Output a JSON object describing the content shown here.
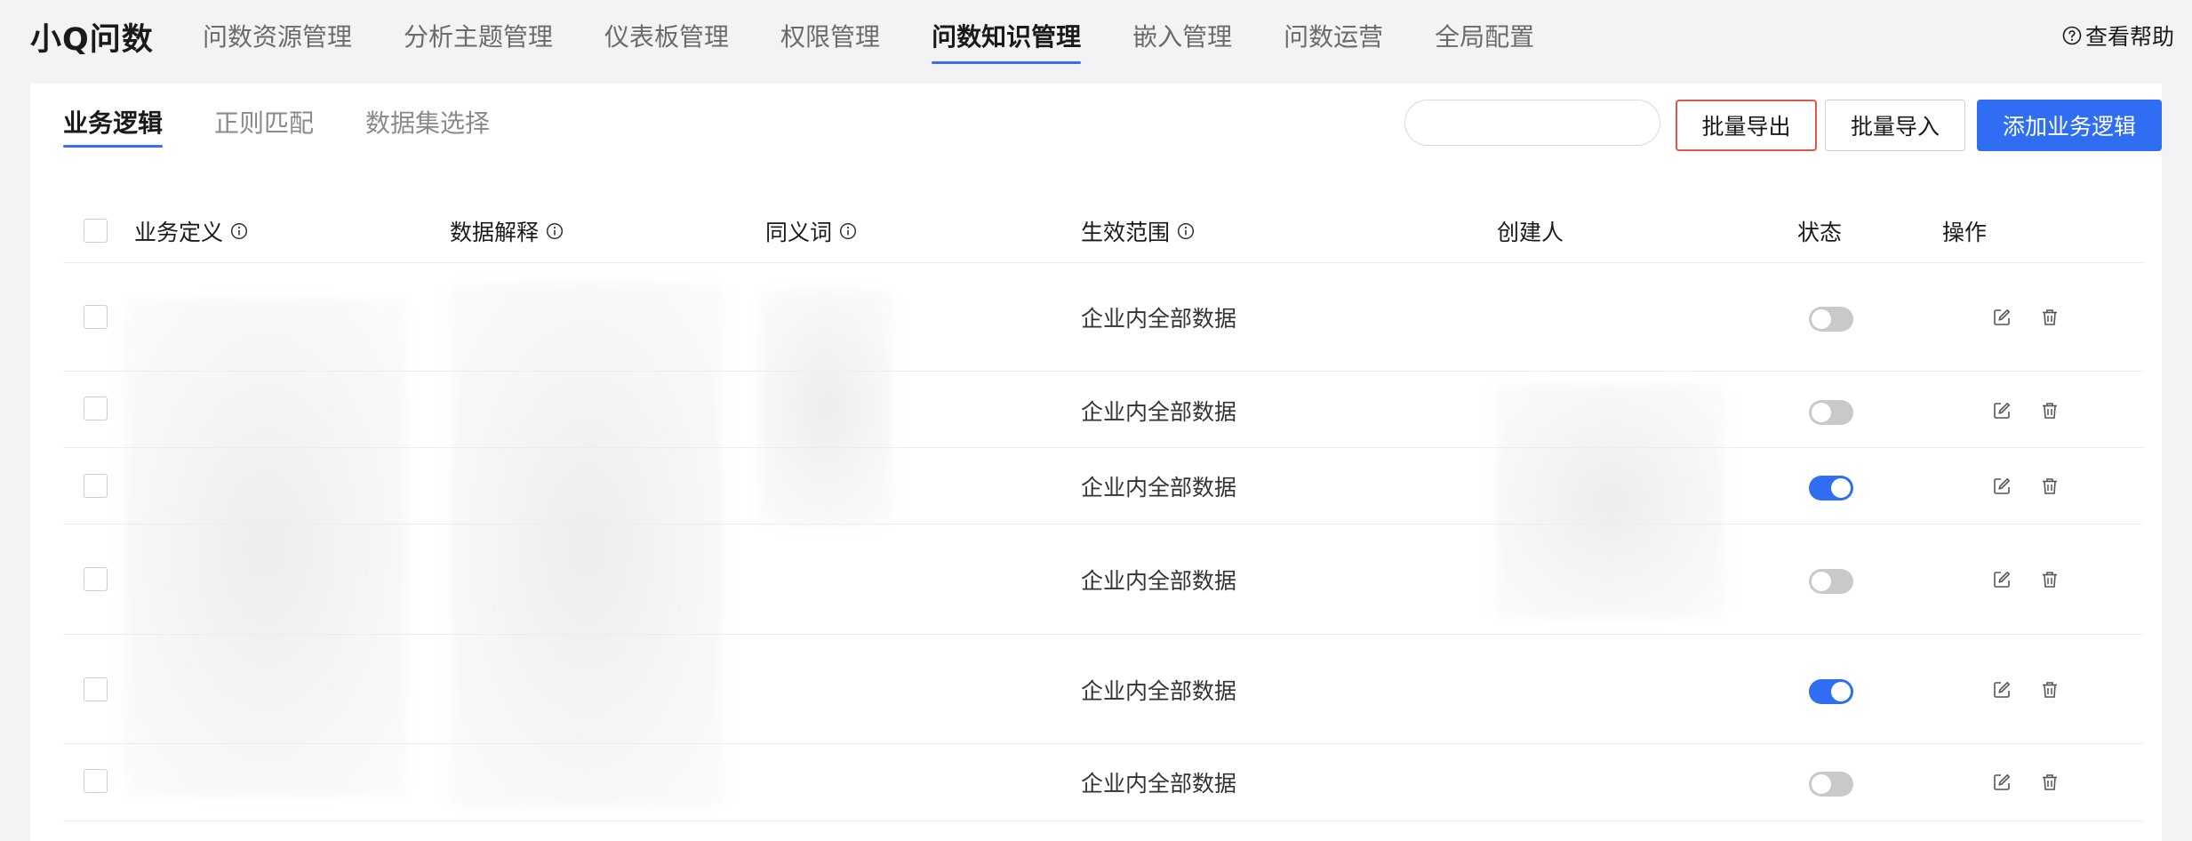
{
  "brand": "小Q问数",
  "nav": [
    {
      "label": "问数资源管理",
      "active": false
    },
    {
      "label": "分析主题管理",
      "active": false
    },
    {
      "label": "仪表板管理",
      "active": false
    },
    {
      "label": "权限管理",
      "active": false
    },
    {
      "label": "问数知识管理",
      "active": true
    },
    {
      "label": "嵌入管理",
      "active": false
    },
    {
      "label": "问数运营",
      "active": false
    },
    {
      "label": "全局配置",
      "active": false
    }
  ],
  "help_label": "查看帮助",
  "subtabs": [
    {
      "label": "业务逻辑",
      "active": true
    },
    {
      "label": "正则匹配",
      "active": false
    },
    {
      "label": "数据集选择",
      "active": false
    }
  ],
  "search": {
    "value": "",
    "placeholder": ""
  },
  "buttons": {
    "export": "批量导出",
    "import": "批量导入",
    "add": "添加业务逻辑"
  },
  "table": {
    "columns": {
      "definition": "业务定义",
      "explanation": "数据解释",
      "synonyms": "同义词",
      "scope": "生效范围",
      "creator": "创建人",
      "status": "状态",
      "actions": "操作"
    },
    "rows": [
      {
        "scope": "企业内全部数据",
        "enabled": false
      },
      {
        "scope": "企业内全部数据",
        "enabled": false
      },
      {
        "scope": "企业内全部数据",
        "enabled": true
      },
      {
        "scope": "企业内全部数据",
        "enabled": false
      },
      {
        "scope": "企业内全部数据",
        "enabled": true
      },
      {
        "scope": "企业内全部数据",
        "enabled": false
      }
    ]
  },
  "colors": {
    "accent": "#2f6ef2",
    "highlight": "#e4564b"
  }
}
